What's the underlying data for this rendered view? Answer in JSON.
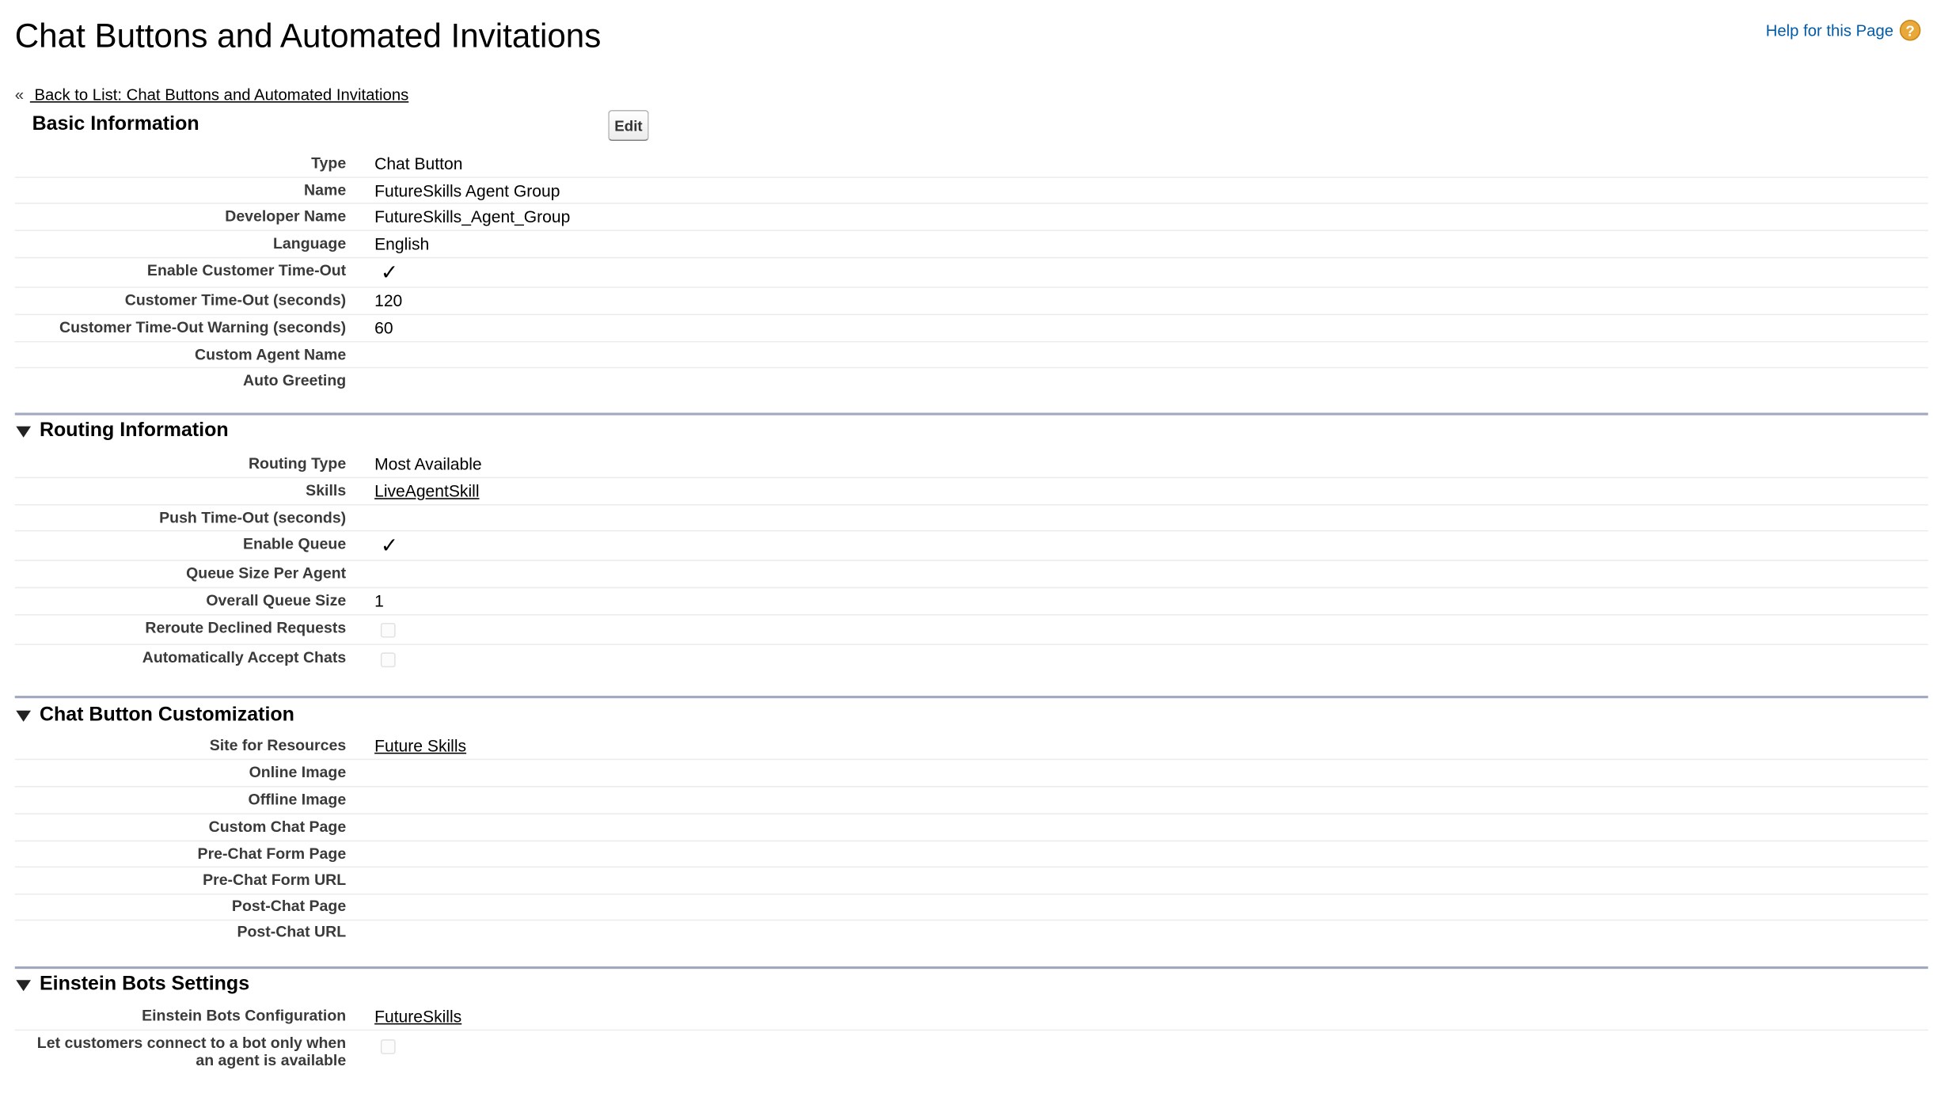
{
  "header": {
    "title": "Chat Buttons and Automated Invitations",
    "help_link": "Help for this Page",
    "help_icon": "help-icon",
    "back_prefix": "«",
    "back_link": " Back to List: Chat Buttons and Automated Invitations"
  },
  "basic": {
    "title": "Basic Information",
    "edit_label": "Edit",
    "type_label": "Type",
    "type_value": "Chat Button",
    "name_label": "Name",
    "name_value": "FutureSkills Agent Group",
    "devname_label": "Developer Name",
    "devname_value": "FutureSkills_Agent_Group",
    "language_label": "Language",
    "language_value": "English",
    "timeout_enabled_label": "Enable Customer Time-Out",
    "timeout_enabled": true,
    "timeout_label": "Customer Time-Out (seconds)",
    "timeout_value": "120",
    "warning_label": "Customer Time-Out Warning (seconds)",
    "warning_value": "60",
    "agent_name_label": "Custom Agent Name",
    "greeting_label": "Auto Greeting"
  },
  "routing": {
    "title": "Routing Information",
    "routing_type_label": "Routing Type",
    "routing_type_value": "Most Available",
    "skills_label": "Skills",
    "skills_value": "LiveAgentSkill",
    "push_timeout_label": "Push Time-Out (seconds)",
    "enable_queue_label": "Enable Queue",
    "enable_queue": true,
    "queue_per_agent_label": "Queue Size Per Agent",
    "overall_queue_label": "Overall Queue Size",
    "overall_queue_value": "1",
    "reroute_label": "Reroute Declined Requests",
    "reroute": false,
    "auto_accept_label": "Automatically Accept Chats",
    "auto_accept": false
  },
  "customization": {
    "title": "Chat Button Customization",
    "site_label": "Site for Resources",
    "site_value": "Future Skills",
    "online_image_label": "Online Image",
    "offline_image_label": "Offline Image",
    "custom_chat_page_label": "Custom Chat Page",
    "prechat_form_page_label": "Pre-Chat Form Page",
    "prechat_form_url_label": "Pre-Chat Form URL",
    "postchat_page_label": "Post-Chat Page",
    "postchat_url_label": "Post-Chat URL"
  },
  "einstein": {
    "title": "Einstein Bots Settings",
    "config_label": "Einstein Bots Configuration",
    "config_value": "FutureSkills",
    "bot_only_label_line1": "Let customers connect to a bot only when",
    "bot_only_label_line2": "an agent is available",
    "bot_only": false
  },
  "glyphs": {
    "check": "✓"
  }
}
